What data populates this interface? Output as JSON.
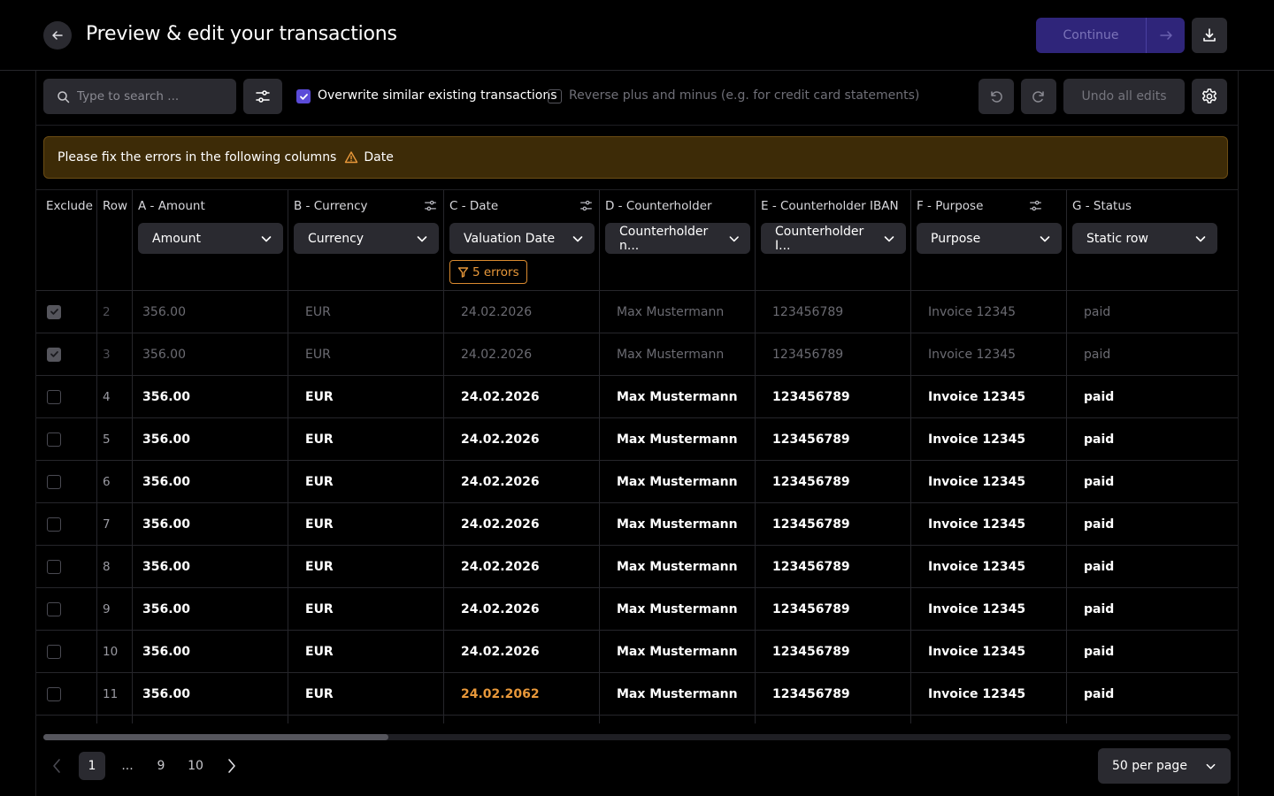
{
  "header": {
    "title": "Preview & edit your transactions",
    "continue_label": "Continue"
  },
  "toolbar": {
    "search_placeholder": "Type to search ...",
    "overwrite_label": "Overwrite similar existing transactions",
    "overwrite_checked": true,
    "reverse_label": "Reverse plus and minus (e.g. for credit card statements)",
    "reverse_checked": false,
    "undo_all_label": "Undo all edits"
  },
  "alert": {
    "message": "Please fix the errors in the following columns",
    "column": "Date"
  },
  "table": {
    "headers": {
      "exclude": "Exclude",
      "row": "Row",
      "a": "A - Amount",
      "b": "B - Currency",
      "c": "C - Date",
      "d": "D - Counterholder",
      "e": "E - Counterholder IBAN",
      "f": "F - Purpose",
      "g": "G - Status"
    },
    "mappings": {
      "a": "Amount",
      "b": "Currency",
      "c": "Valuation Date",
      "d": "Counterholder n...",
      "e": "Counterholder I...",
      "f": "Purpose",
      "g": "Static row"
    },
    "date_errors": "5 errors",
    "rows": [
      {
        "excluded": true,
        "row": "2",
        "amount": "356.00",
        "currency": "EUR",
        "date": "24.02.2026",
        "date_error": false,
        "counterholder": "Max Mustermann",
        "iban": "123456789",
        "purpose": "Invoice 12345",
        "status": "paid"
      },
      {
        "excluded": true,
        "row": "3",
        "amount": "356.00",
        "currency": "EUR",
        "date": "24.02.2026",
        "date_error": false,
        "counterholder": "Max Mustermann",
        "iban": "123456789",
        "purpose": "Invoice 12345",
        "status": "paid"
      },
      {
        "excluded": false,
        "row": "4",
        "amount": "356.00",
        "currency": "EUR",
        "date": "24.02.2026",
        "date_error": false,
        "counterholder": "Max Mustermann",
        "iban": "123456789",
        "purpose": "Invoice 12345",
        "status": "paid"
      },
      {
        "excluded": false,
        "row": "5",
        "amount": "356.00",
        "currency": "EUR",
        "date": "24.02.2026",
        "date_error": false,
        "counterholder": "Max Mustermann",
        "iban": "123456789",
        "purpose": "Invoice 12345",
        "status": "paid"
      },
      {
        "excluded": false,
        "row": "6",
        "amount": "356.00",
        "currency": "EUR",
        "date": "24.02.2026",
        "date_error": false,
        "counterholder": "Max Mustermann",
        "iban": "123456789",
        "purpose": "Invoice 12345",
        "status": "paid"
      },
      {
        "excluded": false,
        "row": "7",
        "amount": "356.00",
        "currency": "EUR",
        "date": "24.02.2026",
        "date_error": false,
        "counterholder": "Max Mustermann",
        "iban": "123456789",
        "purpose": "Invoice 12345",
        "status": "paid"
      },
      {
        "excluded": false,
        "row": "8",
        "amount": "356.00",
        "currency": "EUR",
        "date": "24.02.2026",
        "date_error": false,
        "counterholder": "Max Mustermann",
        "iban": "123456789",
        "purpose": "Invoice 12345",
        "status": "paid"
      },
      {
        "excluded": false,
        "row": "9",
        "amount": "356.00",
        "currency": "EUR",
        "date": "24.02.2026",
        "date_error": false,
        "counterholder": "Max Mustermann",
        "iban": "123456789",
        "purpose": "Invoice 12345",
        "status": "paid"
      },
      {
        "excluded": false,
        "row": "10",
        "amount": "356.00",
        "currency": "EUR",
        "date": "24.02.2026",
        "date_error": false,
        "counterholder": "Max Mustermann",
        "iban": "123456789",
        "purpose": "Invoice 12345",
        "status": "paid"
      },
      {
        "excluded": false,
        "row": "11",
        "amount": "356.00",
        "currency": "EUR",
        "date": "24.02.2062",
        "date_error": true,
        "counterholder": "Max Mustermann",
        "iban": "123456789",
        "purpose": "Invoice 12345",
        "status": "paid"
      }
    ]
  },
  "pagination": {
    "pages": [
      "1",
      "...",
      "9",
      "10"
    ],
    "current": "1",
    "per_page": "50 per page"
  },
  "colors": {
    "accent": "#5b4bd8",
    "continue_bg": "#2f257a",
    "warning_bg": "#3d2b07",
    "error": "#e8983a"
  }
}
